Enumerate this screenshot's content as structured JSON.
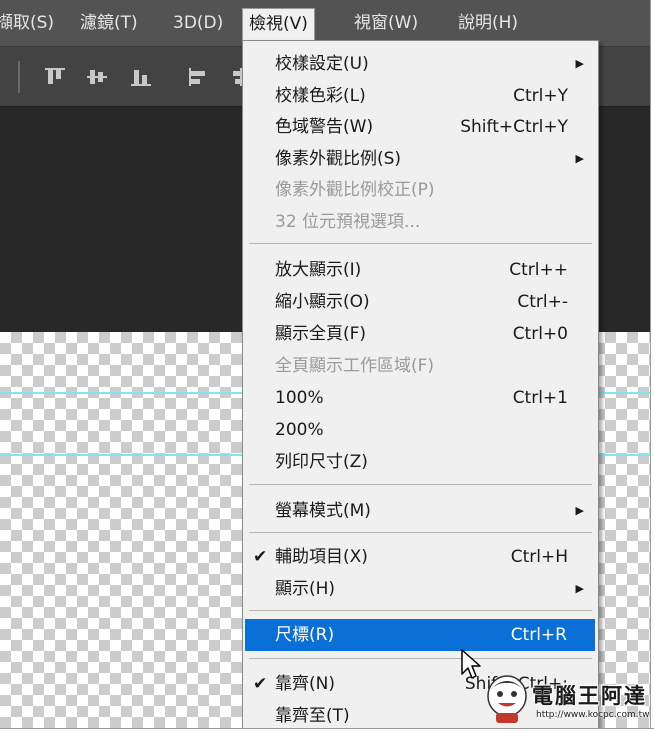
{
  "menubar": {
    "items": [
      {
        "label": "擷取(S)"
      },
      {
        "label": "濾鏡(T)"
      },
      {
        "label": "3D(D)"
      },
      {
        "label": "檢視(V)"
      },
      {
        "label": "視窗(W)"
      },
      {
        "label": "說明(H)"
      }
    ]
  },
  "options_bar": {
    "icons": [
      "align-top-edges-icon",
      "align-vertical-centers-icon",
      "align-bottom-edges-icon",
      "align-left-edges-icon",
      "align-horizontal-centers-icon"
    ]
  },
  "view_menu": {
    "items": [
      {
        "label": "校樣設定(U)",
        "shortcut": "",
        "submenu": true
      },
      {
        "label": "校樣色彩(L)",
        "shortcut": "Ctrl+Y"
      },
      {
        "label": "色域警告(W)",
        "shortcut": "Shift+Ctrl+Y"
      },
      {
        "label": "像素外觀比例(S)",
        "shortcut": "",
        "submenu": true
      },
      {
        "label": "像素外觀比例校正(P)",
        "shortcut": "",
        "disabled": true
      },
      {
        "label": "32 位元預視選項...",
        "shortcut": "",
        "disabled": true
      },
      {
        "label": "放大顯示(I)",
        "shortcut": "Ctrl++"
      },
      {
        "label": "縮小顯示(O)",
        "shortcut": "Ctrl+-"
      },
      {
        "label": "顯示全頁(F)",
        "shortcut": "Ctrl+0"
      },
      {
        "label": "全頁顯示工作區域(F)",
        "shortcut": "",
        "disabled": true
      },
      {
        "label": "100%",
        "shortcut": "Ctrl+1"
      },
      {
        "label": "200%",
        "shortcut": ""
      },
      {
        "label": "列印尺寸(Z)",
        "shortcut": ""
      },
      {
        "label": "螢幕模式(M)",
        "shortcut": "",
        "submenu": true
      },
      {
        "label": "輔助項目(X)",
        "shortcut": "Ctrl+H",
        "checked": true
      },
      {
        "label": "顯示(H)",
        "shortcut": "",
        "submenu": true
      },
      {
        "label": "尺標(R)",
        "shortcut": "Ctrl+R",
        "highlighted": true
      },
      {
        "label": "靠齊(N)",
        "shortcut": "Shift+Ctrl+;",
        "checked": true
      },
      {
        "label": "靠齊至(T)",
        "shortcut": ""
      }
    ],
    "check_glyph": "✔",
    "submenu_glyph": "▶"
  },
  "watermark": {
    "title": "電腦王阿達",
    "url": "http://www.kocpc.com.tw"
  },
  "colors": {
    "menubar_bg": "#535353",
    "highlight": "#0a6fd6",
    "guide": "#7ee7ee"
  }
}
